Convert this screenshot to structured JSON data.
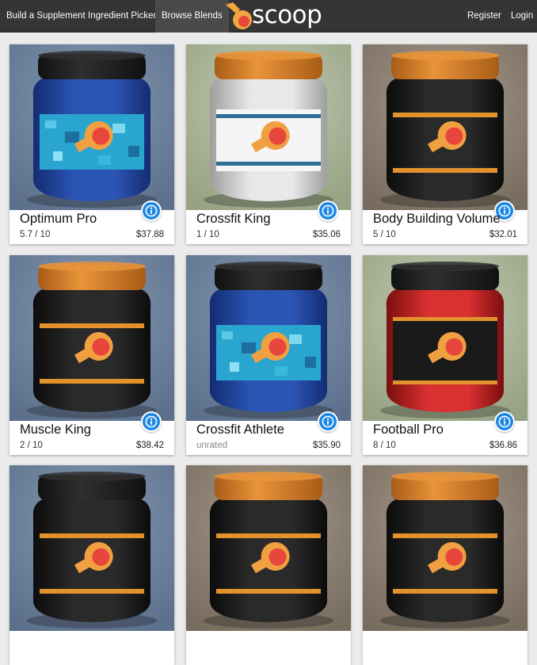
{
  "nav": {
    "build": "Build a Supplement",
    "picker": "Ingredient Picker",
    "browse": "Browse Blends",
    "brand": "scoop",
    "register": "Register",
    "login": "Login"
  },
  "colors": {
    "navbar": "#353535",
    "info_button": "#1e88e5",
    "scoop_orange": "#f0a040"
  },
  "products": [
    {
      "name": "Optimum Pro",
      "rating": "5.7 / 10",
      "price": "$37.88",
      "jar": "blue",
      "lid": "black",
      "backdrop": "blue"
    },
    {
      "name": "Crossfit King",
      "rating": "1 / 10",
      "price": "$35.06",
      "jar": "white",
      "lid": "orange",
      "backdrop": "green"
    },
    {
      "name": "Body Building Volume",
      "rating": "5 / 10",
      "price": "$32.01",
      "jar": "black",
      "lid": "orange",
      "backdrop": "brown"
    },
    {
      "name": "Muscle King",
      "rating": "2 / 10",
      "price": "$38.42",
      "jar": "black",
      "lid": "orange",
      "backdrop": "blue"
    },
    {
      "name": "Crossfit Athlete",
      "rating": "unrated",
      "price": "$35.90",
      "jar": "blue",
      "lid": "black",
      "backdrop": "blue"
    },
    {
      "name": "Football Pro",
      "rating": "8 / 10",
      "price": "$36.86",
      "jar": "red",
      "lid": "black",
      "backdrop": "green"
    },
    {
      "name": "",
      "rating": "",
      "price": "",
      "jar": "black",
      "lid": "black",
      "backdrop": "blue"
    },
    {
      "name": "",
      "rating": "",
      "price": "",
      "jar": "black",
      "lid": "orange",
      "backdrop": "brown"
    },
    {
      "name": "",
      "rating": "",
      "price": "",
      "jar": "black",
      "lid": "orange",
      "backdrop": "brown"
    }
  ]
}
